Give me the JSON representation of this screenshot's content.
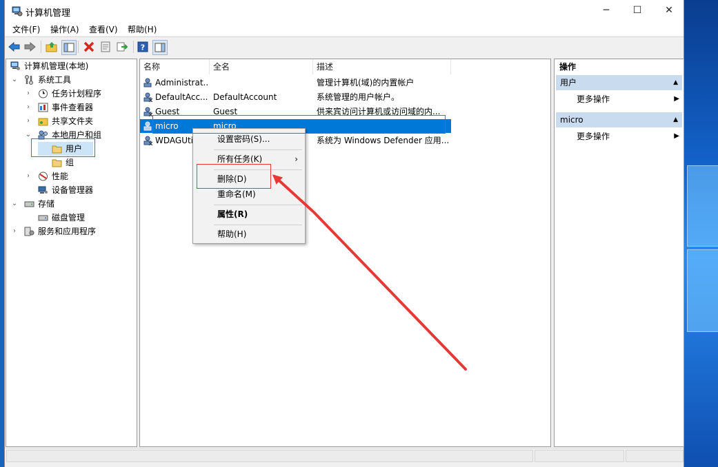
{
  "window": {
    "title": "计算机管理",
    "controls": {
      "minimize": "─",
      "maximize": "☐",
      "close": "✕"
    }
  },
  "menu": [
    "文件(F)",
    "操作(A)",
    "查看(V)",
    "帮助(H)"
  ],
  "toolbar": [
    "back-icon",
    "forward-icon",
    "up-folder-icon",
    "show-tree-icon",
    "delete-icon",
    "properties-icon",
    "export-icon",
    "help-icon",
    "console-icon"
  ],
  "tree": {
    "root": "计算机管理(本地)",
    "items": [
      {
        "label": "系统工具"
      },
      {
        "label": "任务计划程序"
      },
      {
        "label": "事件查看器"
      },
      {
        "label": "共享文件夹"
      },
      {
        "label": "本地用户和组"
      },
      {
        "label": "用户"
      },
      {
        "label": "组"
      },
      {
        "label": "性能"
      },
      {
        "label": "设备管理器"
      },
      {
        "label": "存储"
      },
      {
        "label": "磁盘管理"
      },
      {
        "label": "服务和应用程序"
      }
    ]
  },
  "list": {
    "columns": [
      "名称",
      "全名",
      "描述"
    ],
    "rows": [
      {
        "name": "Administrat...",
        "fullname": "",
        "description": "管理计算机(域)的内置帐户"
      },
      {
        "name": "DefaultAcc...",
        "fullname": "DefaultAccount",
        "description": "系统管理的用户帐户。"
      },
      {
        "name": "Guest",
        "fullname": "Guest",
        "description": "供来宾访问计算机或访问域的内..."
      },
      {
        "name": "micro",
        "fullname": "micro",
        "description": ""
      },
      {
        "name": "WDAGUti",
        "fullname": "",
        "description": "系统为 Windows Defender 应用..."
      }
    ],
    "selected": "micro"
  },
  "context_menu": {
    "items": [
      "设置密码(S)...",
      "所有任务(K)",
      "删除(D)",
      "重命名(M)",
      "属性(R)",
      "帮助(H)"
    ]
  },
  "actions": {
    "header": "操作",
    "sections": [
      {
        "title": "用户",
        "item": "更多操作"
      },
      {
        "title": "micro",
        "item": "更多操作"
      }
    ]
  },
  "colors": {
    "selection": "#0078d7",
    "annotation": "#e53935",
    "section_bg": "#c9dcef"
  }
}
